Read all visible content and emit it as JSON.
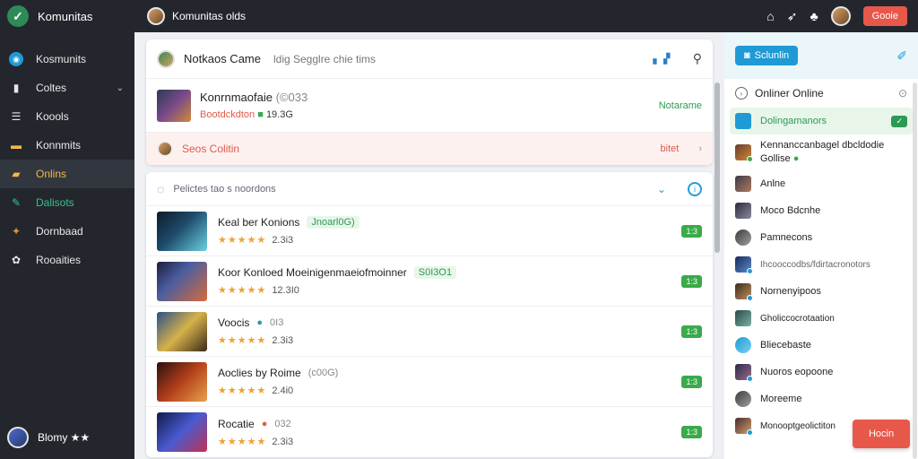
{
  "app": {
    "name": "Komunitas",
    "current_user": "Komunitas olds"
  },
  "topbar": {
    "action_label": "Gooie"
  },
  "sidebar": {
    "items": [
      {
        "label": "Kosmunits",
        "icon": "globe-icon",
        "state": "normal"
      },
      {
        "label": "Coltes",
        "icon": "bag-icon",
        "state": "normal",
        "expandable": true
      },
      {
        "label": "Koools",
        "icon": "list-icon",
        "state": "normal"
      },
      {
        "label": "Konnmits",
        "icon": "store-icon",
        "state": "normal"
      },
      {
        "label": "Onlins",
        "icon": "folder-icon",
        "state": "active"
      },
      {
        "label": "Dalisots",
        "icon": "pin-icon",
        "state": "green"
      },
      {
        "label": "Dornbaad",
        "icon": "chat-icon",
        "state": "normal"
      },
      {
        "label": "Rooaities",
        "icon": "gear-icon",
        "state": "normal"
      }
    ],
    "footer_user": "Blomy ★★"
  },
  "main": {
    "header": {
      "title": "Notkaos Came",
      "subtitle": "ldig Segglre chie tims"
    },
    "featured": {
      "title": "Konrnmaofaie",
      "title_suffix": "(©033",
      "meta": "Bootdckdton",
      "meta_num": "19.3G",
      "status": "Notarame"
    },
    "alert": {
      "text": "Seos Colitin",
      "action": "bitet"
    },
    "list_header": "Pelictes tao s noordons",
    "games": [
      {
        "name": "Keal ber Konions",
        "tag": "Jnoarl0G)",
        "tag_type": "green",
        "rating": "2.3i3",
        "badge": "1:3",
        "thumb": "g1"
      },
      {
        "name": "Koor Konloed Moeinigenmaeiofmoinner",
        "tag": "S0I3O1",
        "tag_type": "green",
        "rating": "12.3I0",
        "badge": "1:3",
        "thumb": "g2"
      },
      {
        "name": "Voocis",
        "tag": "0I3",
        "tag_type": "teal",
        "rating": "2.3i3",
        "badge": "1:3",
        "thumb": "g3"
      },
      {
        "name": "Aoclies by Roime",
        "tag": "(c00G)",
        "tag_type": "plain",
        "rating": "2.4i0",
        "badge": "1:3",
        "thumb": "g4"
      },
      {
        "name": "Rocatie",
        "tag": "032",
        "tag_type": "orange",
        "rating": "2.3i3",
        "badge": "1:3",
        "thumb": "g5"
      }
    ]
  },
  "right_panel": {
    "button_label": "Sclunlin",
    "header": "Onliner Online",
    "items": [
      {
        "name": "Dolingamanors",
        "style": "highlight",
        "icon": "blue",
        "badge": "✓"
      },
      {
        "name": "Kennanccanbagel dbcldodie Gollise",
        "style": "multi",
        "icon": "fa",
        "dot": true
      },
      {
        "name": "Anlne",
        "icon": "fb"
      },
      {
        "name": "Moco Bdcnhe",
        "icon": "fc"
      },
      {
        "name": "Pamnecons",
        "icon": "fi"
      },
      {
        "name": "Ihcooccodbs/fdirtacronotors",
        "icon": "fd"
      },
      {
        "name": "Nornenyipoos",
        "icon": "fe"
      },
      {
        "name": "Gholiccocrotaation",
        "icon": "ff"
      },
      {
        "name": "Bliecebaste",
        "icon": "fg"
      },
      {
        "name": "Nuoros eopoone",
        "icon": "fh"
      },
      {
        "name": "Moreeme",
        "icon": "fi"
      },
      {
        "name": "Monooptgeolictiton",
        "icon": "fj"
      }
    ],
    "fab_label": "Hocin"
  }
}
